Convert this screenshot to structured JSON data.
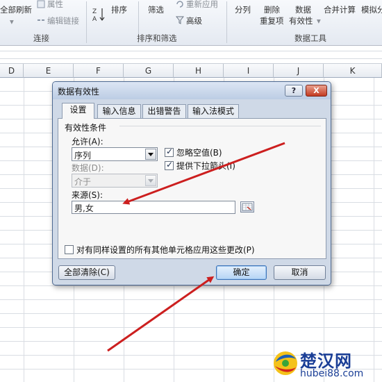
{
  "ribbon": {
    "refresh_all": "全部刷新",
    "properties": "属性",
    "edit_links": "编辑链接",
    "sort": "排序",
    "filter": "筛选",
    "reapply": "重新应用",
    "advanced": "高级",
    "split": "分列",
    "remove_dup_1": "删除",
    "remove_dup_2": "重复项",
    "validation_1": "数据",
    "validation_2": "有效性",
    "consolidate": "合并计算",
    "whatif": "模拟分",
    "group_connections": "连接",
    "group_sort_filter": "排序和筛选",
    "group_data_tools": "数据工具"
  },
  "columns": [
    "E",
    "F",
    "G",
    "H",
    "I",
    "J",
    "K"
  ],
  "dialog": {
    "title": "数据有效性",
    "help_label": "?",
    "close_label": "X",
    "tabs": [
      "设置",
      "输入信息",
      "出错警告",
      "输入法模式"
    ],
    "active_tab": 0,
    "section_label": "有效性条件",
    "allow_label": "允许(A):",
    "allow_value": "序列",
    "data_label": "数据(D):",
    "data_value": "介于",
    "ignore_blank_label": "忽略空值(B)",
    "ignore_blank_checked": true,
    "dropdown_label": "提供下拉箭头(I)",
    "dropdown_checked": true,
    "source_label": "来源(S):",
    "source_value": "男,女",
    "apply_all_label": "对有同样设置的所有其他单元格应用这些更改(P)",
    "apply_all_checked": false,
    "clear_all_label": "全部清除(C)",
    "ok_label": "确定",
    "cancel_label": "取消"
  },
  "watermark": {
    "name": "楚汉网",
    "url": "hubei88.com"
  },
  "colors": {
    "annotation_arrow": "#cc1f1f",
    "dialog_bg": "#cfd9e7",
    "close_button": "#c33b22"
  }
}
